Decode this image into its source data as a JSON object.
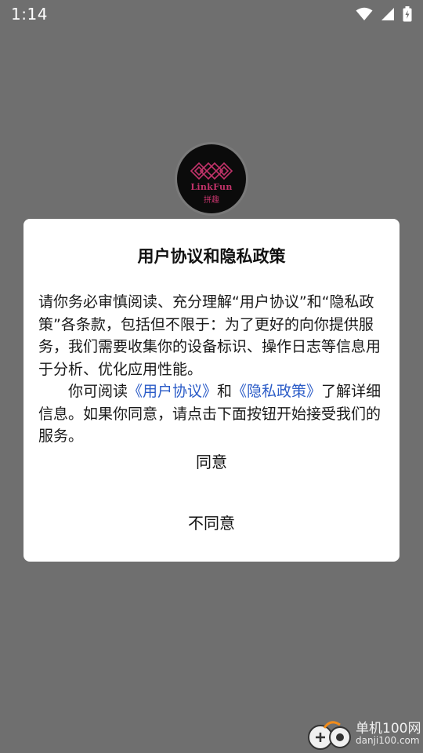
{
  "status_bar": {
    "time": "1:14",
    "icons": [
      "wifi-icon",
      "cell-signal-icon",
      "battery-charging-icon"
    ]
  },
  "logo": {
    "name": "LinkFun",
    "subtitle": "拼趣"
  },
  "dialog": {
    "title": "用户协议和隐私政策",
    "paragraph1": "请你务必审慎阅读、充分理解“用户协议”和“隐私政策”各条款，包括但不限于：为了更好的向你提供服务，我们需要收集你的设备标识、操作日志等信息用于分析、优化应用性能。",
    "paragraph2_prefix": "你可阅读",
    "user_agreement_link": "《用户协议》",
    "paragraph2_and": "和",
    "privacy_policy_link": "《隐私政策》",
    "paragraph2_suffix": "了解详细信息。如果你同意，请点击下面按钮开始接受我们的服务。",
    "agree_label": "同意",
    "disagree_label": "不同意"
  },
  "watermark": {
    "title": "单机100网",
    "url": "danji100.com"
  },
  "colors": {
    "overlay": "#6f6f6f",
    "link": "#2a5bc7",
    "logo_accent": "#c2336a",
    "watermark_accent": "#f28c1a"
  }
}
